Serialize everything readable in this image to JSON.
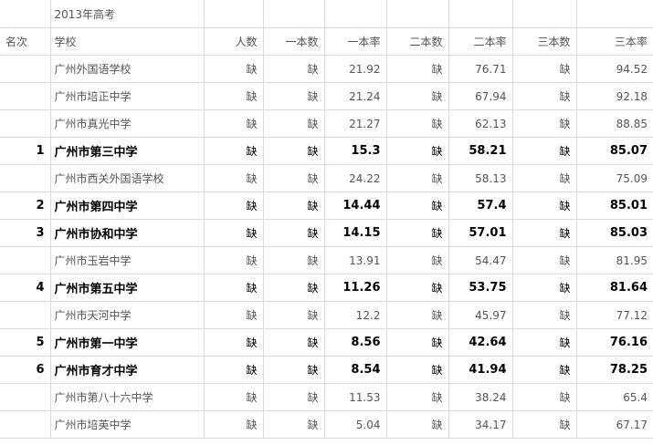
{
  "title": "2013年高考",
  "headers": {
    "rank": "名次",
    "school": "学校",
    "total": "人数",
    "tier1": "一本数",
    "tier1_rate": "一本率",
    "tier2": "二本数",
    "tier2_rate": "二本率",
    "tier3": "三本数",
    "tier3_rate": "三本率"
  },
  "rows": [
    {
      "rank": "",
      "school": "广州外国语学校",
      "total": "缺",
      "tier1": "缺",
      "tier1_rate": "21.92",
      "tier2": "缺",
      "tier2_rate": "76.71",
      "tier3": "缺",
      "tier3_rate": "94.52",
      "bold": false
    },
    {
      "rank": "",
      "school": "广州市培正中学",
      "total": "缺",
      "tier1": "缺",
      "tier1_rate": "21.24",
      "tier2": "缺",
      "tier2_rate": "67.94",
      "tier3": "缺",
      "tier3_rate": "92.18",
      "bold": false
    },
    {
      "rank": "",
      "school": "广州市真光中学",
      "total": "缺",
      "tier1": "缺",
      "tier1_rate": "21.27",
      "tier2": "缺",
      "tier2_rate": "62.13",
      "tier3": "缺",
      "tier3_rate": "88.85",
      "bold": false
    },
    {
      "rank": "1",
      "school": "广州市第三中学",
      "total": "缺",
      "tier1": "缺",
      "tier1_rate": "15.3",
      "tier2": "缺",
      "tier2_rate": "58.21",
      "tier3": "缺",
      "tier3_rate": "85.07",
      "bold": true
    },
    {
      "rank": "",
      "school": "广州市西关外国语学校",
      "total": "缺",
      "tier1": "缺",
      "tier1_rate": "24.22",
      "tier2": "缺",
      "tier2_rate": "58.13",
      "tier3": "缺",
      "tier3_rate": "75.09",
      "bold": false
    },
    {
      "rank": "2",
      "school": "广州市第四中学",
      "total": "缺",
      "tier1": "缺",
      "tier1_rate": "14.44",
      "tier2": "缺",
      "tier2_rate": "57.4",
      "tier3": "缺",
      "tier3_rate": "85.01",
      "bold": true
    },
    {
      "rank": "3",
      "school": "广州市协和中学",
      "total": "缺",
      "tier1": "缺",
      "tier1_rate": "14.15",
      "tier2": "缺",
      "tier2_rate": "57.01",
      "tier3": "缺",
      "tier3_rate": "85.03",
      "bold": true
    },
    {
      "rank": "",
      "school": "广州市玉岩中学",
      "total": "缺",
      "tier1": "缺",
      "tier1_rate": "13.91",
      "tier2": "缺",
      "tier2_rate": "54.47",
      "tier3": "缺",
      "tier3_rate": "81.95",
      "bold": false
    },
    {
      "rank": "4",
      "school": "广州市第五中学",
      "total": "缺",
      "tier1": "缺",
      "tier1_rate": "11.26",
      "tier2": "缺",
      "tier2_rate": "53.75",
      "tier3": "缺",
      "tier3_rate": "81.64",
      "bold": true
    },
    {
      "rank": "",
      "school": "广州市天河中学",
      "total": "缺",
      "tier1": "缺",
      "tier1_rate": "12.2",
      "tier2": "缺",
      "tier2_rate": "45.97",
      "tier3": "缺",
      "tier3_rate": "77.12",
      "bold": false
    },
    {
      "rank": "5",
      "school": "广州市第一中学",
      "total": "缺",
      "tier1": "缺",
      "tier1_rate": "8.56",
      "tier2": "缺",
      "tier2_rate": "42.64",
      "tier3": "缺",
      "tier3_rate": "76.16",
      "bold": true
    },
    {
      "rank": "6",
      "school": "广州市育才中学",
      "total": "缺",
      "tier1": "缺",
      "tier1_rate": "8.54",
      "tier2": "缺",
      "tier2_rate": "41.94",
      "tier3": "缺",
      "tier3_rate": "78.25",
      "bold": true
    },
    {
      "rank": "",
      "school": "广州市第八十六中学",
      "total": "缺",
      "tier1": "缺",
      "tier1_rate": "11.53",
      "tier2": "缺",
      "tier2_rate": "38.24",
      "tier3": "缺",
      "tier3_rate": "65.4",
      "bold": false
    },
    {
      "rank": "",
      "school": "广州市培英中学",
      "total": "缺",
      "tier1": "缺",
      "tier1_rate": "5.04",
      "tier2": "缺",
      "tier2_rate": "34.17",
      "tier3": "缺",
      "tier3_rate": "67.17",
      "bold": false
    }
  ]
}
